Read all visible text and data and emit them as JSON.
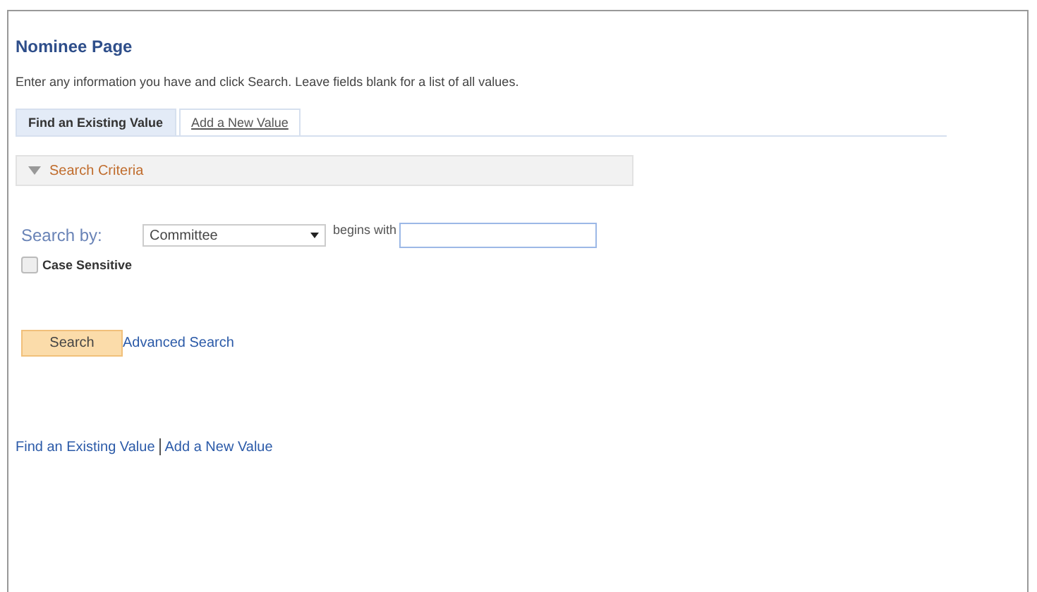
{
  "page": {
    "title": "Nominee Page",
    "instructions": "Enter any information you have and click Search. Leave fields blank for a list of all values."
  },
  "tabs": [
    {
      "label": "Find an Existing Value",
      "selected": true
    },
    {
      "label": "Add a New Value",
      "selected": false
    }
  ],
  "criteria": {
    "label": "Search Criteria",
    "expanded": true
  },
  "search_by": {
    "label": "Search by:",
    "value": "Committee",
    "operator": "begins with"
  },
  "case_sensitive": {
    "label": "Case Sensitive",
    "checked": false
  },
  "search_button": "Search",
  "advanced_link": "Advanced Search",
  "footer_links": [
    "Find an Existing Value",
    "Add a New Value"
  ]
}
